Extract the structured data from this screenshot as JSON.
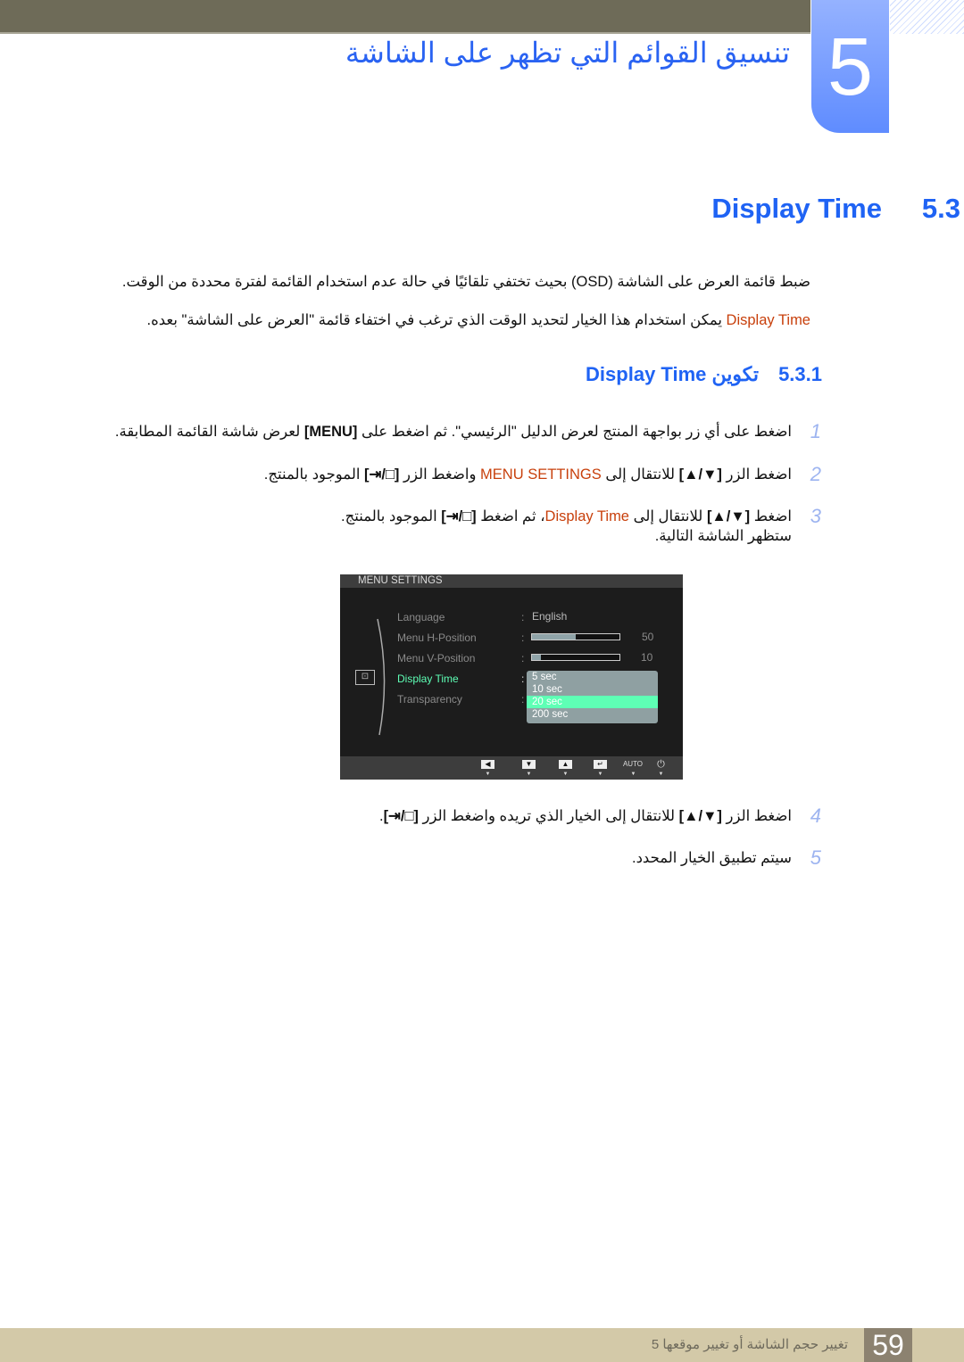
{
  "chapter": {
    "number": "5",
    "title": "تنسيق القوائم التي تظهر على الشاشة"
  },
  "section": {
    "number": "5.3",
    "title": "Display Time"
  },
  "intro": {
    "p1": "ضبط قائمة العرض على الشاشة (OSD) بحيث تختفي تلقائيًا في حالة عدم استخدام القائمة لفترة محددة من الوقت.",
    "p2_highlight": "Display Time",
    "p2": " يمكن استخدام هذا الخيار لتحديد الوقت الذي ترغب في اختفاء قائمة \"العرض على الشاشة\" بعده."
  },
  "subsection": {
    "number": "5.3.1",
    "title": "تكوين Display Time"
  },
  "keys": {
    "updown": "[▲/▼]",
    "enter": "[⇥/□]",
    "menu": "[MENU]"
  },
  "steps": [
    {
      "num": "1",
      "a": "اضغط على أي زر بواجهة المنتج لعرض الدليل \"الرئيسي\". ثم اضغط على ",
      "b": " لعرض شاشة القائمة المطابقة."
    },
    {
      "num": "2",
      "a": "اضغط الزر ",
      "b": " للانتقال إلى ",
      "hl": "MENU SETTINGS",
      "c": " واضغط الزر ",
      "d": " الموجود بالمنتج."
    },
    {
      "num": "3",
      "a": "اضغط ",
      "b": " للانتقال إلى ",
      "hl": "Display Time",
      "c": "، ثم اضغط ",
      "d": " الموجود بالمنتج.",
      "line2": "ستظهر الشاشة التالية."
    },
    {
      "num": "4",
      "a": "اضغط الزر ",
      "b": " للانتقال إلى الخيار الذي تريده واضغط الزر ",
      "d": "."
    },
    {
      "num": "5",
      "a": "سيتم تطبيق الخيار المحدد."
    }
  ],
  "osd": {
    "title": "MENU SETTINGS",
    "items": [
      {
        "label": "Language",
        "value": "English"
      },
      {
        "label": "Menu H-Position",
        "value": "50",
        "level": 50
      },
      {
        "label": "Menu V-Position",
        "value": "10",
        "level": 10
      },
      {
        "label": "Display Time"
      },
      {
        "label": "Transparency"
      }
    ],
    "options": [
      "5 sec",
      "10 sec",
      "20 sec",
      "200 sec"
    ],
    "selected_option": "20 sec",
    "buttons": [
      "◀",
      "▼",
      "▲",
      "↵",
      "AUTO",
      "⏻"
    ],
    "colors": {
      "active": "#5effb5"
    }
  },
  "footer": {
    "page": "59",
    "text": "تغيير حجم الشاشة أو تغيير موقعها 5"
  },
  "colors": {
    "accent": "#1f63f4",
    "highlight": "#c8400c"
  }
}
